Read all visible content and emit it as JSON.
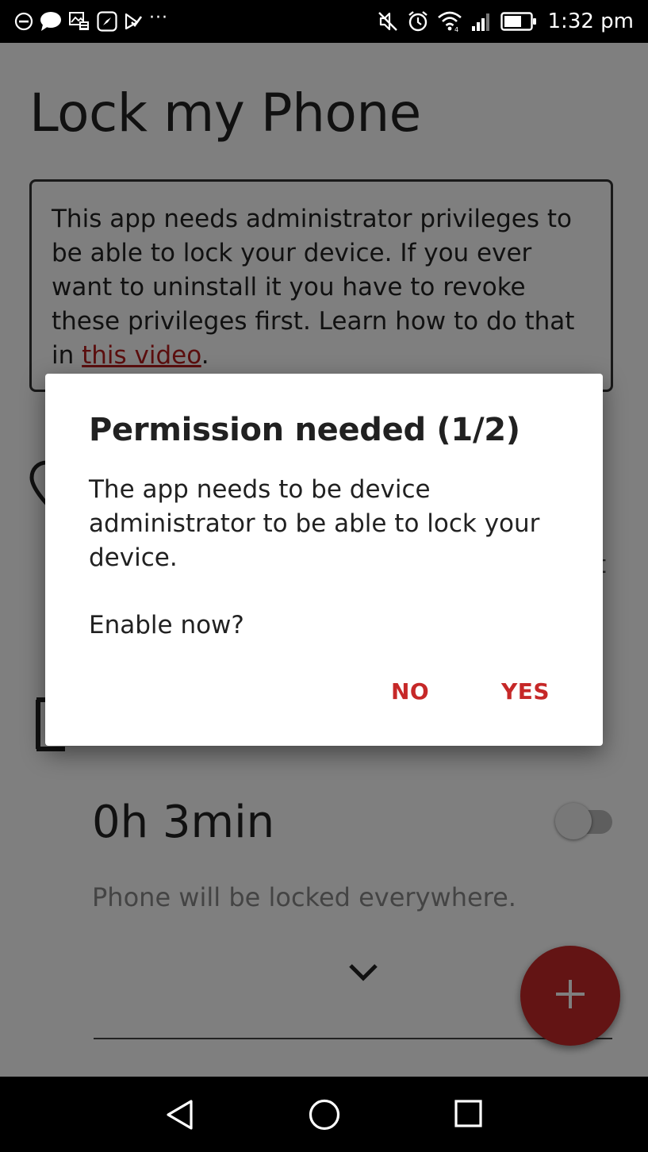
{
  "status_bar": {
    "time": "1:32 pm",
    "overflow": "···",
    "left_icons": [
      "do-not-disturb-icon",
      "chat-bubble-icon",
      "gallery-icon",
      "compass-icon",
      "checkmark-flag-icon"
    ],
    "right_icons": [
      "muted-icon",
      "alarm-icon",
      "wifi-icon",
      "signal-icon",
      "battery-icon"
    ]
  },
  "app": {
    "title": "Lock my Phone",
    "info": {
      "text_before_link": "This app needs administrator privileges to be able to lock your device. If you ever want to uninstall it you have to revoke these privileges first. Learn how to do that in ",
      "link_text": "this video",
      "text_after_link": "."
    },
    "edge_letter": "t",
    "timer": {
      "value": "0h 3min",
      "enabled": false,
      "description": "Phone will be locked everywhere."
    },
    "fab_icon": "plus-icon",
    "accent_color": "#c62828"
  },
  "dialog": {
    "title": "Permission needed (1/2)",
    "message": "The app needs to be device administrator to be able to lock your device.",
    "question": "Enable now?",
    "buttons": {
      "no": "NO",
      "yes": "YES"
    }
  },
  "nav_bar": {
    "icons": [
      "back-icon",
      "home-icon",
      "recents-icon"
    ]
  }
}
